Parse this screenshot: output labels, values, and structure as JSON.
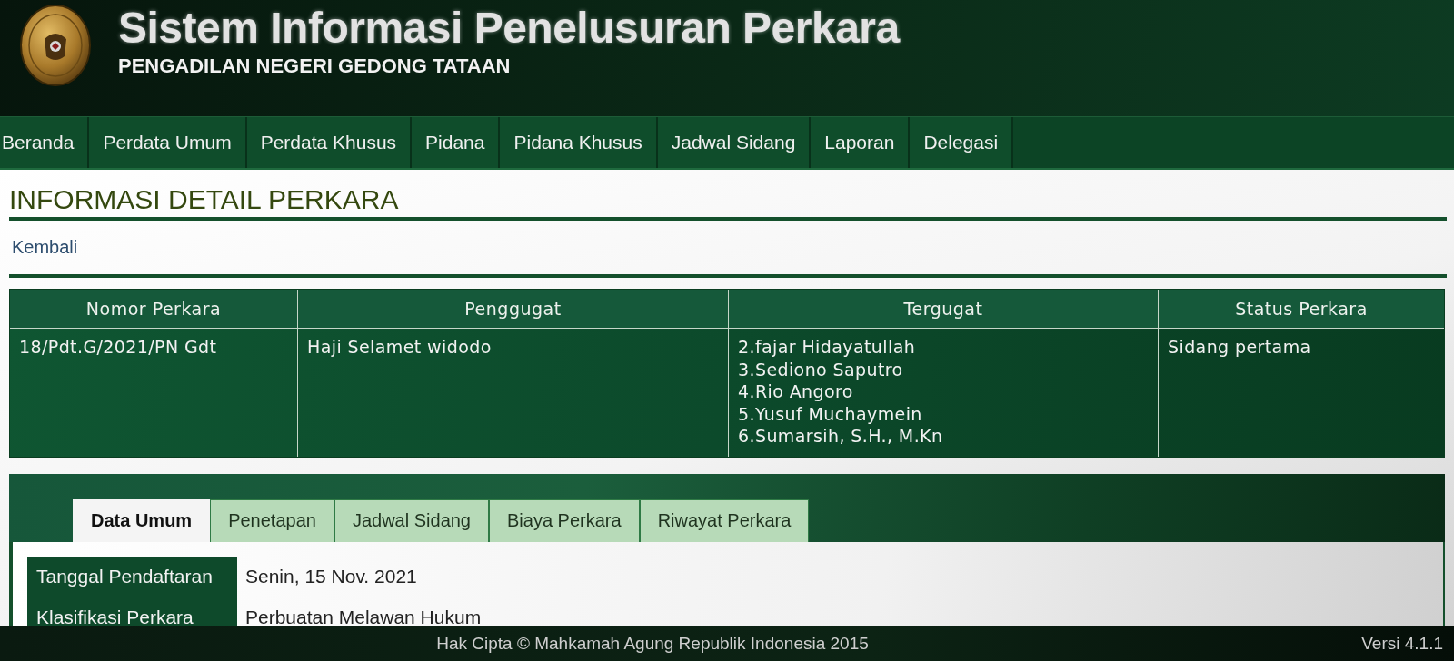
{
  "header": {
    "title": "Sistem Informasi Penelusuran Perkara",
    "subtitle": "PENGADILAN NEGERI GEDONG TATAAN"
  },
  "nav": {
    "items": [
      "Beranda",
      "Perdata Umum",
      "Perdata Khusus",
      "Pidana",
      "Pidana Khusus",
      "Jadwal Sidang",
      "Laporan",
      "Delegasi"
    ]
  },
  "page": {
    "heading": "INFORMASI DETAIL PERKARA",
    "back_link": "Kembali"
  },
  "case_table": {
    "columns": [
      "Nomor Perkara",
      "Penggugat",
      "Tergugat",
      "Status Perkara"
    ],
    "rows": [
      {
        "cells": [
          [
            "18/Pdt.G/2021/PN Gdt"
          ],
          [
            "Haji Selamet widodo"
          ],
          [
            "2.fajar Hidayatullah",
            "3.Sediono Saputro",
            "4.Rio Angoro",
            "5.Yusuf Muchaymein",
            "6.Sumarsih, S.H., M.Kn"
          ],
          [
            "Sidang pertama"
          ]
        ]
      }
    ]
  },
  "detail_tabs": {
    "tabs": [
      {
        "label": "Data Umum",
        "selected": true
      },
      {
        "label": "Penetapan",
        "selected": false
      },
      {
        "label": "Jadwal Sidang",
        "selected": false
      },
      {
        "label": "Biaya Perkara",
        "selected": false
      },
      {
        "label": "Riwayat Perkara",
        "selected": false
      }
    ],
    "fields": [
      {
        "label": "Tanggal Pendaftaran",
        "value": "Senin, 15 Nov. 2021"
      },
      {
        "label": "Klasifikasi Perkara",
        "value": "Perbuatan Melawan Hukum"
      }
    ]
  },
  "footer": {
    "copyright": "Hak Cipta © Mahkamah Agung Republik Indonesia 2015",
    "version": "Versi 4.1.1"
  }
}
